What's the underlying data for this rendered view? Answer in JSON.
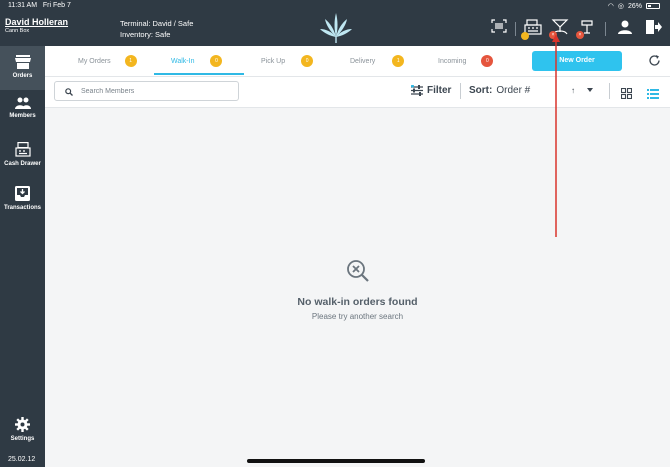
{
  "status": {
    "time": "11:31 AM",
    "date": "Fri Feb 7",
    "battery": "26%"
  },
  "user": {
    "name": "David Holleran",
    "sub": "Cann Box"
  },
  "terminal": {
    "line1": "Terminal: David / Safe",
    "line2": "Inventory: Safe"
  },
  "header_icons": [
    "barcode-icon",
    "register-icon",
    "scale-icon",
    "printer-icon",
    "user-icon",
    "logout-icon"
  ],
  "sidebar": {
    "items": [
      {
        "label": "Orders",
        "icon": "store-icon",
        "active": true
      },
      {
        "label": "Members",
        "icon": "people-icon",
        "active": false
      },
      {
        "label": "Cash Drawer",
        "icon": "cash-drawer-icon",
        "active": false
      },
      {
        "label": "Transactions",
        "icon": "inbox-icon",
        "active": false
      }
    ],
    "settings_label": "Settings",
    "version": "25.02.12"
  },
  "tabs": [
    {
      "label": "My Orders",
      "count": "1",
      "active": false,
      "badge_color": "#f3b61f"
    },
    {
      "label": "Walk-In",
      "count": "0",
      "active": true,
      "badge_color": "#f3b61f"
    },
    {
      "label": "Pick Up",
      "count": "0",
      "active": false,
      "badge_color": "#f3b61f"
    },
    {
      "label": "Delivery",
      "count": "1",
      "active": false,
      "badge_color": "#f3b61f"
    },
    {
      "label": "Incoming",
      "count": "0",
      "active": false,
      "badge_color": "#e5553d"
    }
  ],
  "new_order_label": "New Order",
  "search": {
    "placeholder": "Search Members",
    "value": ""
  },
  "filter_label": "Filter",
  "sort": {
    "label": "Sort:",
    "value": "Order #",
    "direction": "↑"
  },
  "empty": {
    "title": "No walk-in orders found",
    "subtitle": "Please try another search"
  },
  "colors": {
    "dark": "#2f3a44",
    "accent": "#2fb9e5",
    "badge_yellow": "#f3b61f",
    "badge_red": "#e5553d",
    "annotation_red": "#d9342b"
  }
}
